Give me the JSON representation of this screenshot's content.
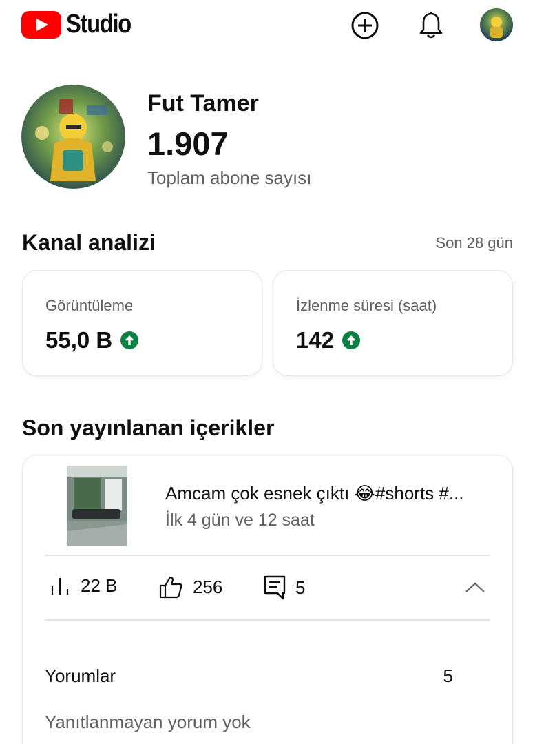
{
  "header": {
    "logo_text": "Studio",
    "brand_color": "#ff0000",
    "create_icon": "add-circle-icon",
    "notifications_icon": "bell-icon"
  },
  "channel": {
    "name": "Fut Tamer",
    "subscriber_count": "1.907",
    "subscriber_label": "Toplam abone sayısı"
  },
  "analytics": {
    "title": "Kanal analizi",
    "period": "Son 28 gün",
    "up_color": "#0b8043",
    "cards": [
      {
        "label": "Görüntüleme",
        "value": "55,0 B",
        "trend": "up"
      },
      {
        "label": "İzlenme süresi (saat)",
        "value": "142",
        "trend": "up"
      }
    ]
  },
  "recent": {
    "title": "Son yayınlanan içerikler",
    "video": {
      "title": "Amcam çok esnek çıktı 😂#shorts #...",
      "subtitle": "İlk 4 gün ve 12 saat",
      "views": "22 B",
      "likes": "256",
      "comments": "5"
    },
    "comments_row": {
      "label": "Yorumlar",
      "value": "5",
      "note": "Yanıtlanmayan yorum yok"
    }
  }
}
